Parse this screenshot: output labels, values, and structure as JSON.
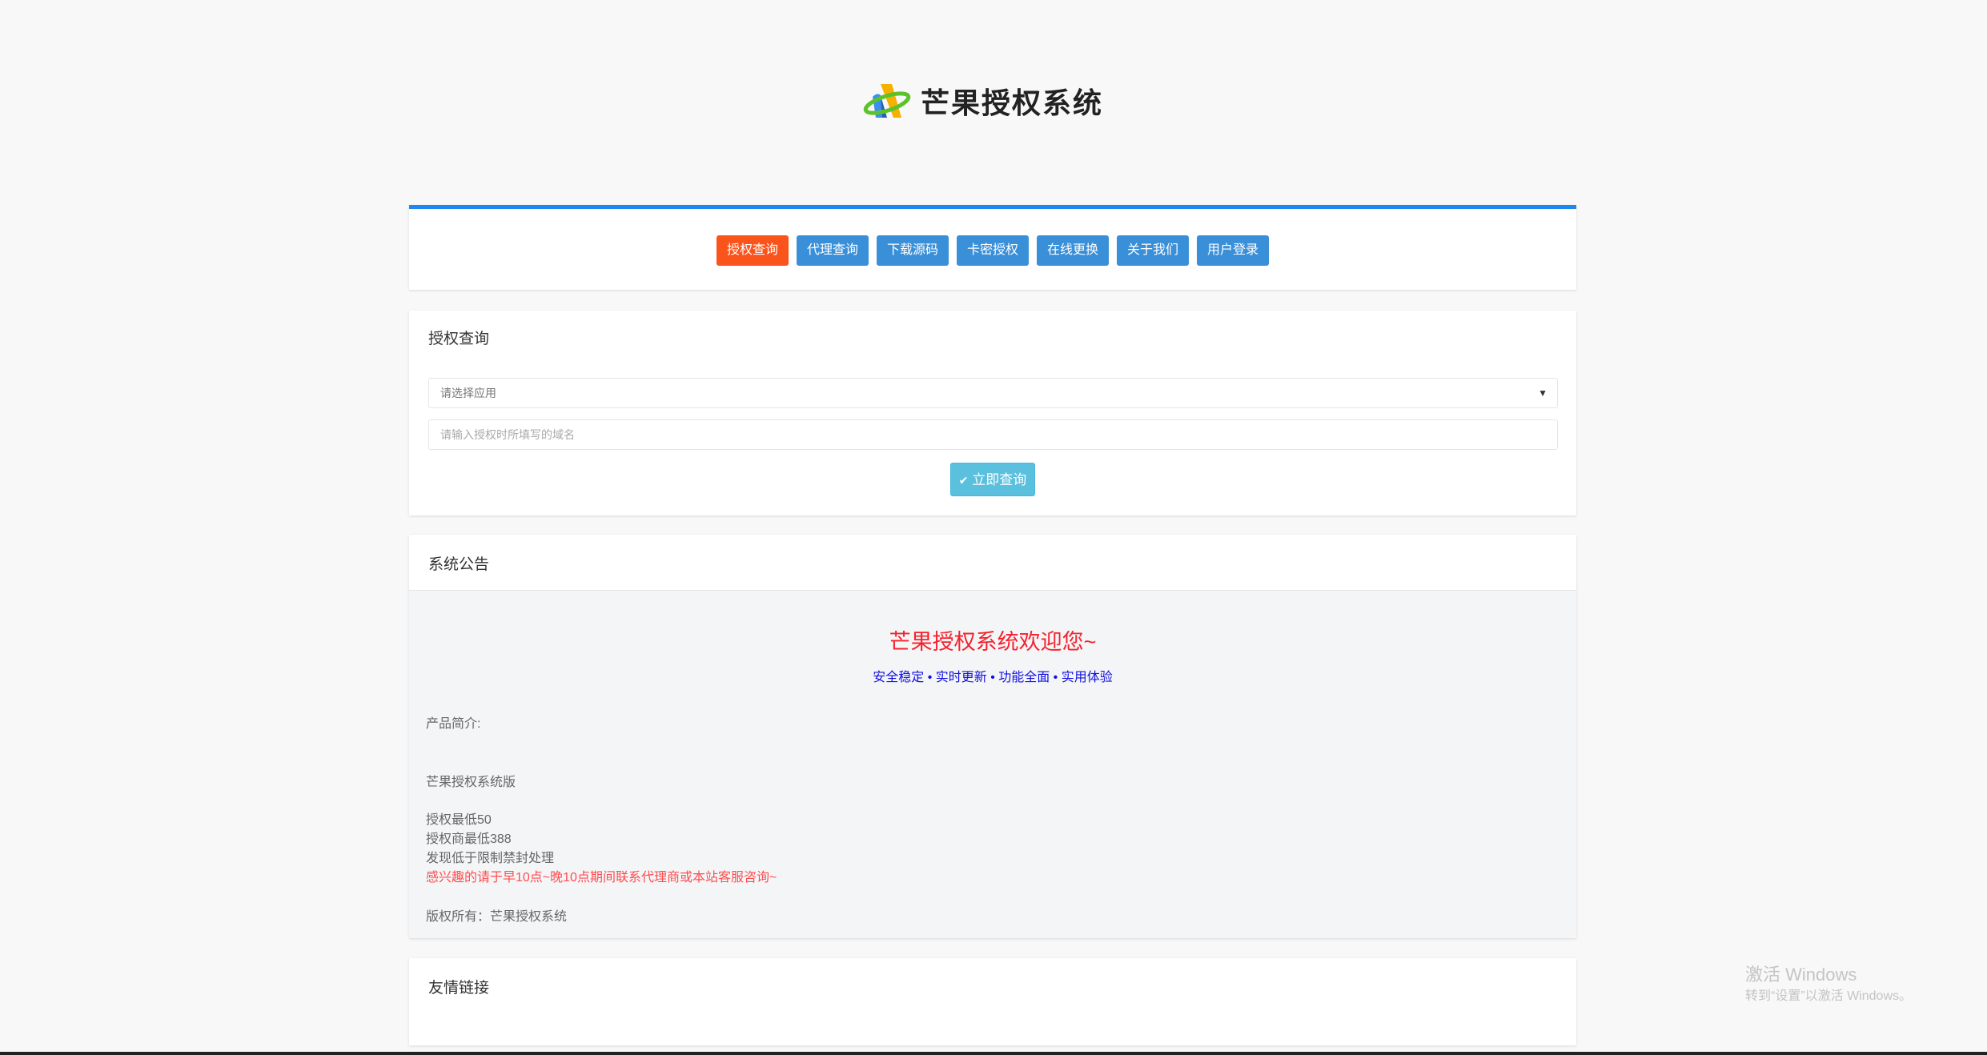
{
  "header": {
    "logo_text": "芒果授权系统"
  },
  "nav": {
    "items": [
      {
        "label": "授权查询",
        "active": true
      },
      {
        "label": "代理查询"
      },
      {
        "label": "下载源码"
      },
      {
        "label": "卡密授权"
      },
      {
        "label": "在线更换"
      },
      {
        "label": "关于我们"
      },
      {
        "label": "用户登录"
      }
    ],
    "colors": {
      "active": "#fa541c",
      "default": "#3a8fd9",
      "accent_bar": "#1e88f0"
    }
  },
  "query": {
    "title": "授权查询",
    "select_value": "请选择应用",
    "domain_placeholder": "请输入授权时所填写的域名",
    "submit_label": "立即查询",
    "submit_icon": "check-circle-icon"
  },
  "notice": {
    "title": "系统公告",
    "welcome": "芒果授权系统欢迎您~",
    "tagline": "安全稳定 • 实时更新 • 功能全面 • 实用体验",
    "intro_label": "产品简介:",
    "edition": "芒果授权系统版",
    "lines": [
      "授权最低50",
      "授权商最低388",
      "发现低于限制禁封处理"
    ],
    "contact": "感兴趣的请于早10点~晚10点期间联系代理商或本站客服咨询~",
    "copyright": "版权所有：芒果授权系统"
  },
  "links": {
    "title": "友情链接"
  },
  "watermark": {
    "title": "激活 Windows",
    "subtitle": "转到“设置”以激活 Windows。"
  }
}
